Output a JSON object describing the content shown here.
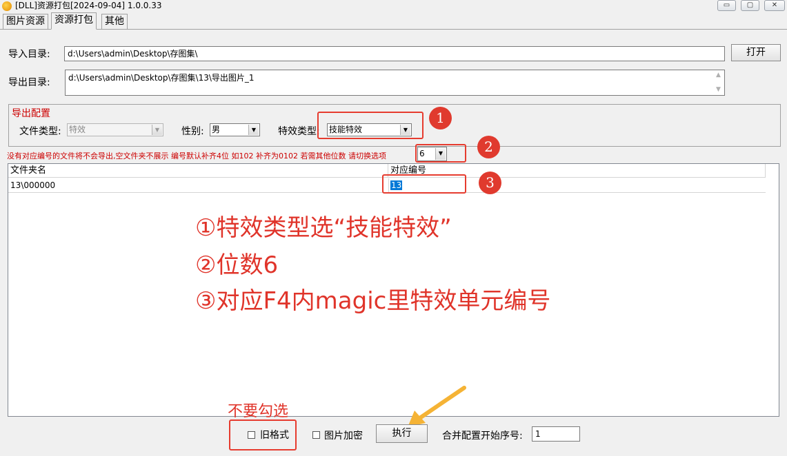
{
  "window": {
    "title": "[DLL]资源打包[2024-09-04] 1.0.0.33",
    "min_glyph": "▭",
    "max_glyph": "▢",
    "close_glyph": "✕"
  },
  "tabs": [
    "图片资源",
    "资源打包",
    "其他"
  ],
  "import": {
    "label": "导入目录:",
    "value": "d:\\Users\\admin\\Desktop\\存图集\\",
    "open_button": "打开"
  },
  "export": {
    "label": "导出目录:",
    "value": "d:\\Users\\admin\\Desktop\\存图集\\13\\导出图片_1"
  },
  "config": {
    "title": "导出配置",
    "file_type_label": "文件类型:",
    "file_type_value": "特效",
    "gender_label": "性别:",
    "gender_value": "男",
    "effect_type_label": "特效类型:",
    "effect_type_value": "技能特效"
  },
  "notice": "没有对应编号的文件将不会导出,空文件夹不展示  编号默认补齐4位 如102 补齐为0102  若需其他位数 请切换选项",
  "digits_value": "6",
  "table": {
    "headers": [
      "文件夹名",
      "对应编号"
    ],
    "rows": [
      {
        "folder": "13\\000000",
        "number": "13"
      }
    ]
  },
  "annotations": {
    "circles": [
      "1",
      "2",
      "3"
    ],
    "notes": [
      "①特效类型选“技能特效”",
      "②位数6",
      "③对应F4内magic里特效单元编号"
    ],
    "dont_check": "不要勾选"
  },
  "bottom": {
    "old_format_label": "旧格式",
    "encrypt_label": "图片加密",
    "execute_button": "执行",
    "start_index_label": "合并配置开始序号:",
    "start_index_value": "1"
  },
  "colors": {
    "annotation_red": "#e03a2e",
    "arrow_yellow": "#f5b335",
    "selection_blue": "#0078d7"
  }
}
